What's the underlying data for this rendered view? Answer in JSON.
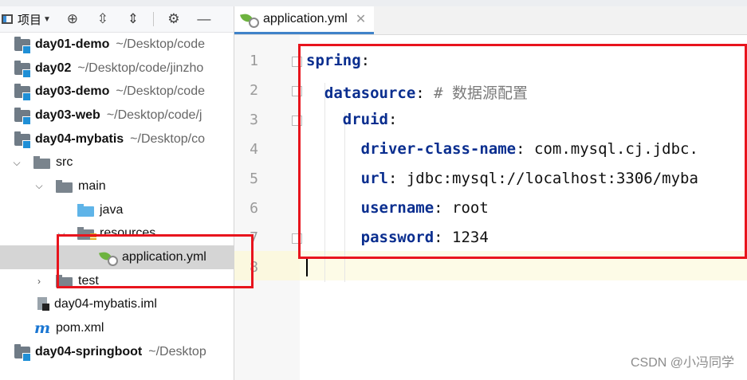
{
  "project_panel": {
    "title": "项目",
    "tree": [
      {
        "name": "day01-demo",
        "path": "~/Desktop/code"
      },
      {
        "name": "day02",
        "path": "~/Desktop/code/jinzho"
      },
      {
        "name": "day03-demo",
        "path": "~/Desktop/code"
      },
      {
        "name": "day03-web",
        "path": "~/Desktop/code/j"
      },
      {
        "name": "day04-mybatis",
        "path": "~/Desktop/co"
      },
      {
        "name": "src"
      },
      {
        "name": "main"
      },
      {
        "name": "java"
      },
      {
        "name": "resources"
      },
      {
        "name": "application.yml"
      },
      {
        "name": "test"
      },
      {
        "name": "day04-mybatis.iml"
      },
      {
        "name": "pom.xml"
      },
      {
        "name": "day04-springboot",
        "path": "~/Desktop"
      }
    ]
  },
  "editor": {
    "tab_label": "application.yml",
    "line_numbers": [
      "1",
      "2",
      "3",
      "4",
      "5",
      "6",
      "7",
      "8"
    ],
    "lines": [
      {
        "key": "spring",
        "sep": ":",
        "value": ""
      },
      {
        "key": "datasource",
        "sep": ":",
        "value": " # 数据源配置"
      },
      {
        "key": "druid",
        "sep": ":",
        "value": ""
      },
      {
        "key": "driver-class-name",
        "sep": ":",
        "value": " com.mysql.cj.jdbc."
      },
      {
        "key": "url",
        "sep": ":",
        "value": " jdbc:mysql://localhost:3306/myba"
      },
      {
        "key": "username",
        "sep": ":",
        "value": " root"
      },
      {
        "key": "password",
        "sep": ":",
        "value": " 1234"
      },
      {
        "key": "",
        "sep": "",
        "value": ""
      }
    ]
  },
  "watermark": "CSDN @小冯同学",
  "colors": {
    "highlight_box": "#e8141d",
    "yaml_key": "#0a2e8f",
    "caret_line": "#fdfbe7"
  }
}
